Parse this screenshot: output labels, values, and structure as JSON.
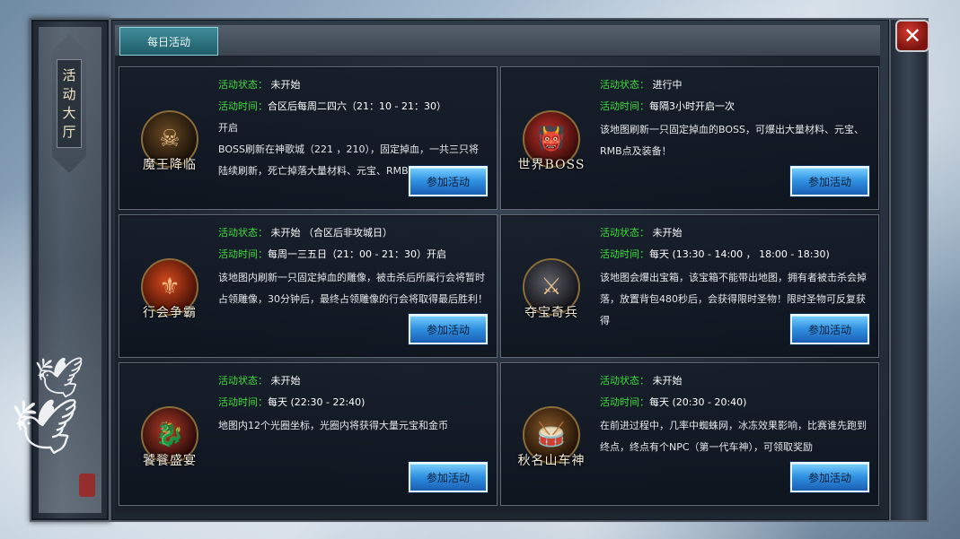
{
  "window": {
    "side_tab_chars": [
      "活",
      "动",
      "大",
      "厅"
    ],
    "tab_daily": "每日活动",
    "close_symbol": "✕"
  },
  "activities": [
    {
      "name": "魔王降临",
      "status_label": "活动状态：",
      "status": "未开始",
      "time_label": "活动时间：",
      "time": "合区后每周二四六（21：10 - 21：30）",
      "desc": "开启\nBOSS刷新在神歌城（221 ，210），固定掉血，一共三只将陆续刷新，死亡掉落大量材料、元宝、RMB点及装备！",
      "button": "参加活动",
      "icon": "demon-icon"
    },
    {
      "name": "世界BOSS",
      "status_label": "活动状态：",
      "status": "进行中",
      "time_label": "活动时间：",
      "time": "每隔3小时开启一次",
      "desc": "该地图刷新一只固定掉血的BOSS，可爆出大量材料、元宝、RMB点及装备！",
      "button": "参加活动",
      "icon": "boss-icon"
    },
    {
      "name": "行会争霸",
      "status_label": "活动状态：",
      "status": "未开始",
      "status_note": "（合区后非攻城日）",
      "time_label": "活动时间：",
      "time": "每周一三五日（21：00 - 21：30）开启",
      "desc": "该地图内刷新一只固定掉血的雕像，被击杀后所属行会将暂时占领雕像，30分钟后，最终占领雕像的行会将取得最后胜利！",
      "button": "参加活动",
      "icon": "guild-crest-icon"
    },
    {
      "name": "夺宝奇兵",
      "status_label": "活动状态：",
      "status": "未开始",
      "time_label": "活动时间：",
      "time": "每天 (13:30 - 14:00 ， 18:00 - 18:30)",
      "desc": "该地图会爆出宝箱，该宝箱不能带出地图，拥有者被击杀会掉落，放置背包480秒后，会获得限时圣物！限时圣物可反复获得",
      "button": "参加活动",
      "icon": "raider-icon"
    },
    {
      "name": "饕餮盛宴",
      "status_label": "活动状态：",
      "status": "未开始",
      "time_label": "活动时间：",
      "time": "每天 (22:30 - 22:40)",
      "desc": "地图内12个光圈坐标，光圈内将获得大量元宝和金币",
      "button": "参加活动",
      "icon": "beast-mask-icon"
    },
    {
      "name": "秋名山车神",
      "status_label": "活动状态：",
      "status": "未开始",
      "time_label": "活动时间：",
      "time": "每天 (20:30 - 20:40)",
      "desc": "在前进过程中，几率中蜘蛛网，冰冻效果影响，比赛谁先跑到终点，终点有个NPC（第一代车神），可领取奖励",
      "button": "参加活动",
      "icon": "drum-icon"
    }
  ]
}
